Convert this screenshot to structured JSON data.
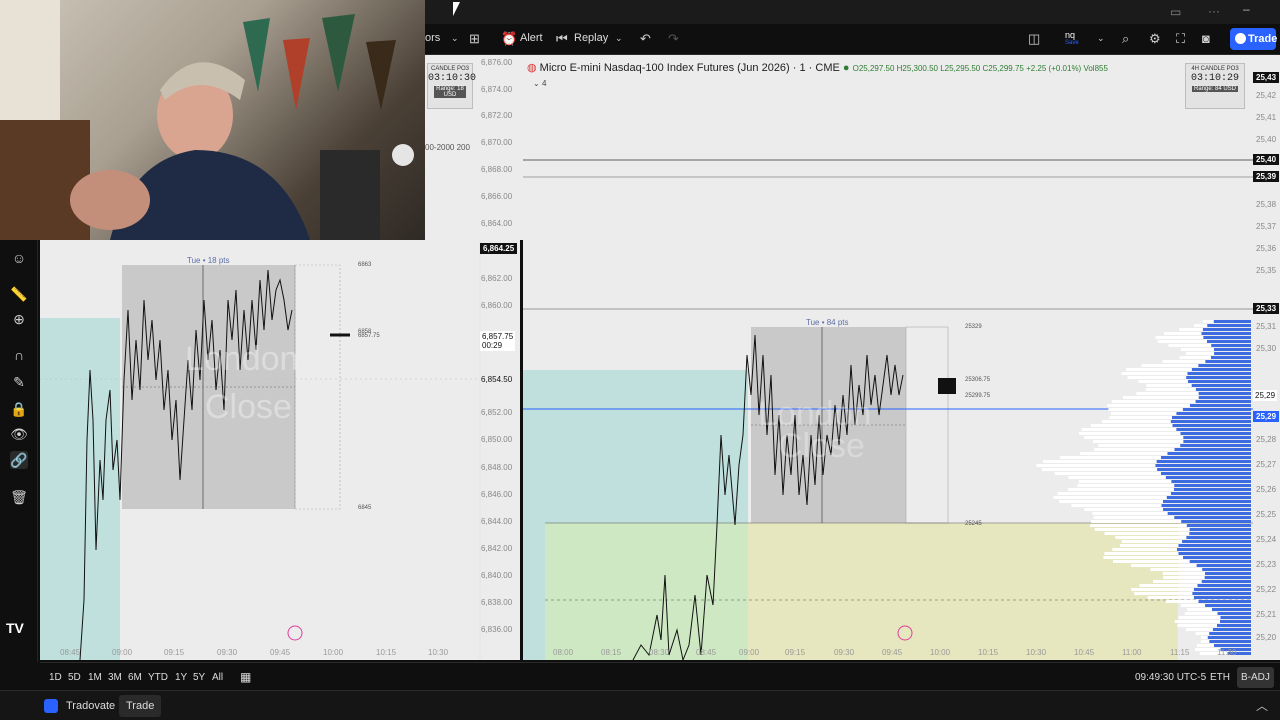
{
  "toolbar": {
    "partial_label": "ors",
    "alert_label": "Alert",
    "replay_label": "Replay",
    "symbol_input": "nq",
    "symbol_sub": "Save",
    "trade_label": "Trade"
  },
  "header": {
    "symbol_title": "Micro E-mini Nasdaq-100 Index Futures (Jun 2026) · 1 · CME",
    "ohlc": "O25,297.50 H25,300.50 L25,295.50 C25,299.75 +2.25 (+0.01%) Vol855",
    "indicator_count": "4"
  },
  "candle_cards": {
    "right": {
      "title": "4H CANDLE PO3",
      "time": "03:10:29",
      "range": "Range: 84 USD"
    },
    "left": {
      "title": "CANDLE PO3",
      "time": "03:10:30",
      "range": "Range: 18 USD"
    }
  },
  "left_chart": {
    "box_label": "Tue • 18 pts",
    "watermark": "London Close",
    "price_ticks": [
      "6,876.00",
      "6,874.00",
      "6,872.00",
      "6,870.00",
      "6,868.00",
      "6,866.00",
      "6,864.00",
      "6,862.00",
      "6,860.00",
      "6,858.00",
      "6,856.00",
      "6,854.00",
      "6,852.00",
      "6,850.00",
      "6,848.00",
      "6,846.00",
      "6,844.00",
      "6,842.00",
      "6,840.00",
      "6,838.00",
      "6,836.00"
    ],
    "tag_high": "6,864.25",
    "tag_current": "6,857.75",
    "tag_countdown": "00:29",
    "tag_level": "6,854.50",
    "label_top": "6863",
    "label_bottom": "6845",
    "label_mid_a": "6858",
    "label_mid_b": "6857.75",
    "range_text": "00-2000 200",
    "time_ticks": [
      "08:45",
      "09:00",
      "09:15",
      "09:30",
      "09:45",
      "10:00",
      "10:15",
      "10:30"
    ]
  },
  "right_chart": {
    "box_label": "Tue • 84 pts",
    "watermark": "London Close",
    "level_top": "25329",
    "level_bottom": "25245",
    "level_a": "25306.75",
    "level_b": "25299.75",
    "tags": [
      "25,43",
      "25,40",
      "25,39",
      "25,33",
      "25,29",
      "25,29"
    ],
    "price_ticks": [
      "25,42",
      "25,41",
      "25,40",
      "25,39",
      "25,38",
      "25,37",
      "25,36",
      "25,35",
      "25,34",
      "25,32",
      "25,31",
      "25,30",
      "25,28",
      "25,27",
      "25,26",
      "25,25",
      "25,24",
      "25,23",
      "25,22",
      "25,21",
      "25,20"
    ],
    "time_ticks": [
      "08:00",
      "08:15",
      "08:30",
      "08:45",
      "09:00",
      "09:15",
      "09:30",
      "09:45",
      "10:00",
      "10:15",
      "10:30",
      "10:45",
      "11:00",
      "11:15",
      "11:30"
    ]
  },
  "bottombar": {
    "ranges": [
      "1D",
      "5D",
      "1M",
      "3M",
      "6M",
      "YTD",
      "1Y",
      "5Y",
      "All"
    ],
    "clock": "09:49:30 UTC-5",
    "session": "ETH",
    "adj": "B-ADJ"
  },
  "statusbar": {
    "broker": "Tradovate",
    "trade_tab": "Trade"
  },
  "colors": {
    "accent": "#2962ff",
    "box_gray": "#c9c9c9",
    "teal_zone": "#bfe0dc",
    "green_zone": "#cfe8c4",
    "yellow_zone": "#e6e6bf",
    "volume_profile": "#3d6be0"
  }
}
